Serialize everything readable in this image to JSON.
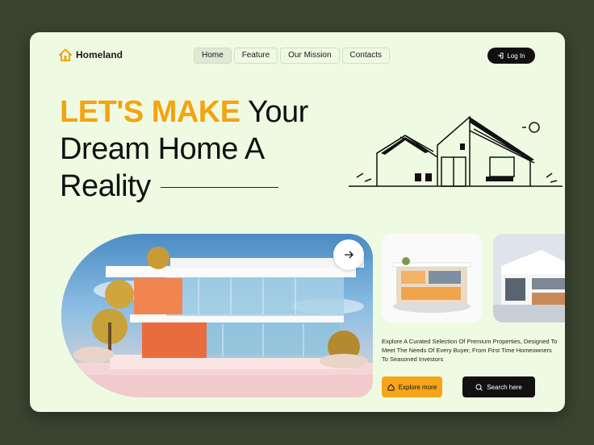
{
  "brand": {
    "name": "Homeland",
    "accent": "#f5a30f"
  },
  "nav": {
    "items": [
      {
        "label": "Home",
        "active": true
      },
      {
        "label": "Feature",
        "active": false
      },
      {
        "label": "Our Mission",
        "active": false
      },
      {
        "label": "Contacts",
        "active": false
      }
    ],
    "login_label": "Log In"
  },
  "hero": {
    "headline_highlight": "LET'S MAKE",
    "headline_rest_1": " Your",
    "headline_line_2": "Dream Home A",
    "headline_line_3": "Reality"
  },
  "description": "Explore A Curated Selection Of Premium Properties, Designed To Meet The Needs Of Every Buyer, From First Time Homeowners To Seasoned Investors",
  "buttons": {
    "explore_label": "Explore more",
    "search_label": "Search here"
  },
  "icons": {
    "logo": "house-icon",
    "login": "login-icon",
    "arrow": "arrow-right-icon",
    "explore": "home-icon",
    "search": "search-icon"
  }
}
